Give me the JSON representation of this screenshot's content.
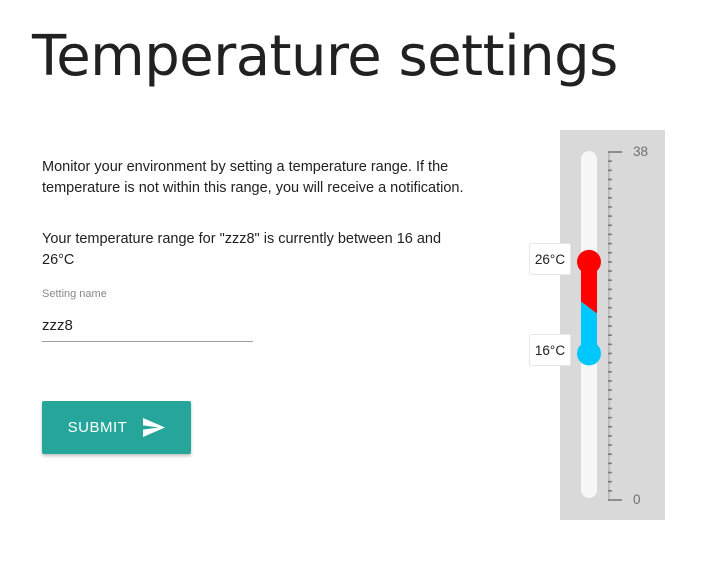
{
  "page": {
    "title": "Temperature settings"
  },
  "content": {
    "intro_text": "Monitor your environment by setting a temperature range. If the temperature is not within this range, you will receive a notification.",
    "range_text": "Your temperature range for \"zzz8\" is currently between 16 and 26°C"
  },
  "form": {
    "name_label": "Setting name",
    "name_value": "zzz8",
    "submit_label": "SUBMIT"
  },
  "thermometer": {
    "scale_min": 0,
    "scale_max": 38,
    "scale_min_label": "0",
    "scale_max_label": "38",
    "high_value": 26,
    "low_value": 16,
    "high_label": "26°C",
    "low_label": "16°C",
    "high_color": "#ff0000",
    "low_color": "#00c8ff",
    "accent_color": "#26a69a"
  }
}
